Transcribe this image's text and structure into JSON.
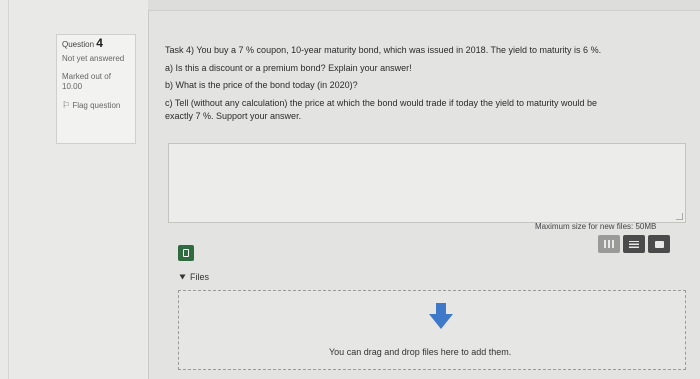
{
  "question": {
    "label": "Question",
    "number": "4",
    "status": "Not yet answered",
    "marked": "Marked out of",
    "marks": "10.00",
    "flag": "Flag question"
  },
  "task": {
    "line1": "Task 4) You buy a 7 % coupon, 10-year maturity bond, which was issued in 2018. The yield to maturity is 6 %.",
    "a": "a) Is this a discount or a premium bond? Explain your answer!",
    "b": "b) What is the price of the bond today (in 2020)?",
    "c1": "c) Tell (without any calculation) the price at which the bond would trade if today the yield to maturity would be",
    "c2": "exactly 7 %. Support your answer."
  },
  "upload": {
    "max_size": "Maximum size for new files: 50MB",
    "files_label": "Files",
    "drop_text": "You can drag and drop files here to add them."
  },
  "colors": {
    "file_icon": "#2f6b3e",
    "arrow": "#3d78c9"
  }
}
